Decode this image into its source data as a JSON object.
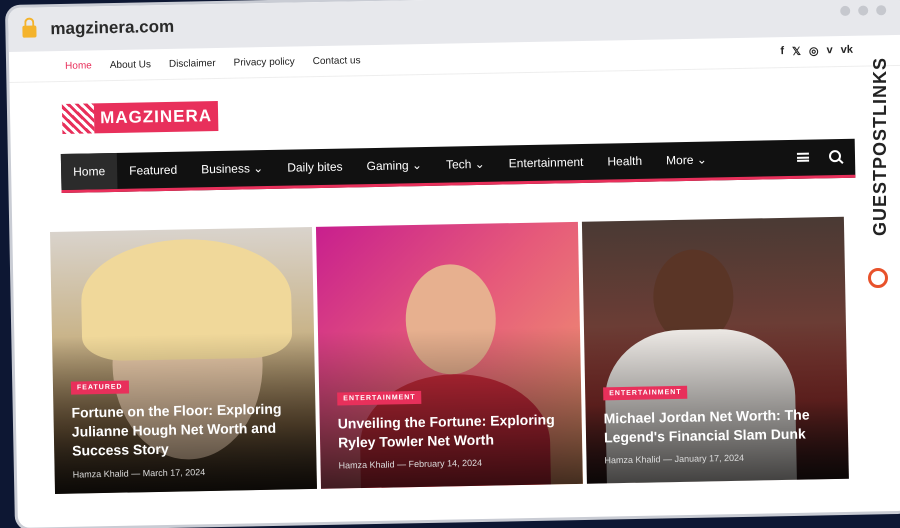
{
  "browser": {
    "url": "magzinera.com"
  },
  "topbar": {
    "links": [
      "Home",
      "About Us",
      "Disclaimer",
      "Privacy policy",
      "Contact us"
    ],
    "social_icons": [
      "facebook-icon",
      "x-icon",
      "instagram-icon",
      "vimeo-icon",
      "vk-icon"
    ],
    "social_glyphs": [
      "f",
      "𝕏",
      "◎",
      "v",
      "vk"
    ]
  },
  "logo": {
    "text": "MAGZINERA"
  },
  "nav": {
    "items": [
      "Home",
      "Featured",
      "Business ⌄",
      "Daily bites",
      "Gaming ⌄",
      "Tech ⌄",
      "Entertainment",
      "Health",
      "More ⌄"
    ]
  },
  "cards": [
    {
      "badge": "FEATURED",
      "title": "Fortune on the Floor: Exploring Julianne Hough Net Worth and Success Story",
      "author": "Hamza Khalid",
      "date": "March 17, 2024"
    },
    {
      "badge": "ENTERTAINMENT",
      "title": "Unveiling the Fortune: Exploring Ryley Towler Net Worth",
      "author": "Hamza Khalid",
      "date": "February 14, 2024"
    },
    {
      "badge": "ENTERTAINMENT",
      "title": "Michael Jordan Net Worth: The Legend's Financial Slam Dunk",
      "author": "Hamza Khalid",
      "date": "January 17, 2024"
    }
  ],
  "watermark": {
    "text": "GUESTPOSTLINKS"
  },
  "colors": {
    "accent": "#e8305b",
    "nav_bg": "#111111"
  }
}
